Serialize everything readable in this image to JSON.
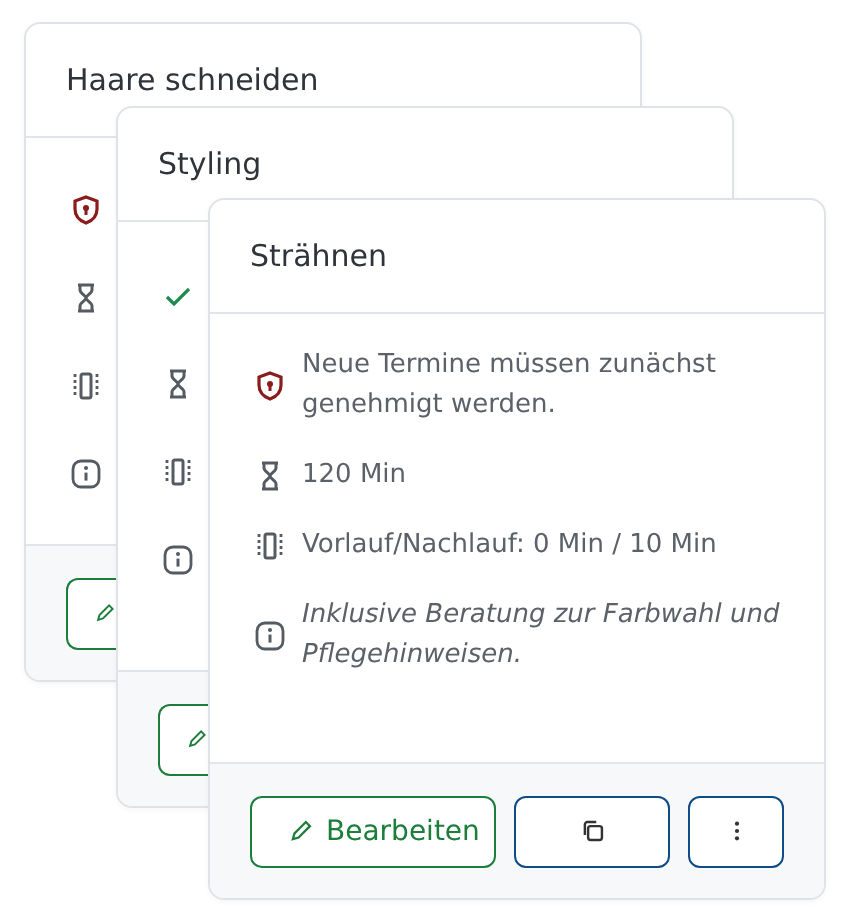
{
  "cards": [
    {
      "title": "Haare schneiden",
      "rows": [
        {
          "kind": "restricted"
        },
        {
          "kind": "duration"
        },
        {
          "kind": "buffer"
        },
        {
          "kind": "info"
        }
      ],
      "buttons": [
        {
          "kind": "edit"
        }
      ]
    },
    {
      "title": "Styling",
      "rows": [
        {
          "kind": "approved"
        },
        {
          "kind": "duration"
        },
        {
          "kind": "buffer"
        },
        {
          "kind": "info"
        }
      ],
      "buttons": [
        {
          "kind": "edit"
        }
      ]
    },
    {
      "title": "Strähnen",
      "rows": [
        {
          "kind": "restricted",
          "text": "Neue Termine müssen zunächst genehmigt werden."
        },
        {
          "kind": "duration",
          "text": "120 Min"
        },
        {
          "kind": "buffer",
          "text": "Vorlauf/Nachlauf: 0 Min / 10 Min"
        },
        {
          "kind": "info",
          "text": "Inklusive Beratung zur Farbwahl und Pflegehinweisen."
        }
      ],
      "buttons": [
        {
          "kind": "edit",
          "label": "Bearbeiten"
        },
        {
          "kind": "copy"
        },
        {
          "kind": "more"
        }
      ]
    }
  ]
}
